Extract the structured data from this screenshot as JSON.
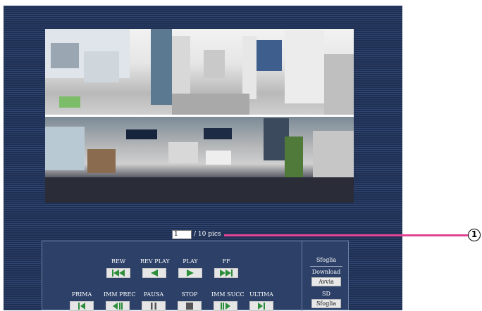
{
  "colors": {
    "panel_bg": "#2b3d63",
    "callout": "#e04393",
    "button_icon": "#2c8d3b"
  },
  "viewer": {
    "frame_value": "1",
    "frame_total": "/ 10 pics"
  },
  "callout": {
    "number": "1"
  },
  "controls": {
    "row1": [
      {
        "label": "REW",
        "icon": "rewind-icon"
      },
      {
        "label": "REV PLAY",
        "icon": "reverse-play-icon"
      },
      {
        "label": "PLAY",
        "icon": "play-icon"
      },
      {
        "label": "FF",
        "icon": "fast-forward-icon"
      }
    ],
    "row2": [
      {
        "label": "PRIMA",
        "icon": "first-frame-icon"
      },
      {
        "label": "IMM PREC",
        "icon": "previous-frame-icon"
      },
      {
        "label": "PAUSA",
        "icon": "pause-icon"
      },
      {
        "label": "STOP",
        "icon": "stop-icon"
      },
      {
        "label": "IMM SUCC",
        "icon": "next-frame-icon"
      },
      {
        "label": "ULTIMA",
        "icon": "last-frame-icon"
      }
    ]
  },
  "side": {
    "title": "Sfoglia",
    "download_label": "Download",
    "download_button": "Avvia",
    "sd_label": "SD",
    "sd_button": "Sfoglia"
  }
}
